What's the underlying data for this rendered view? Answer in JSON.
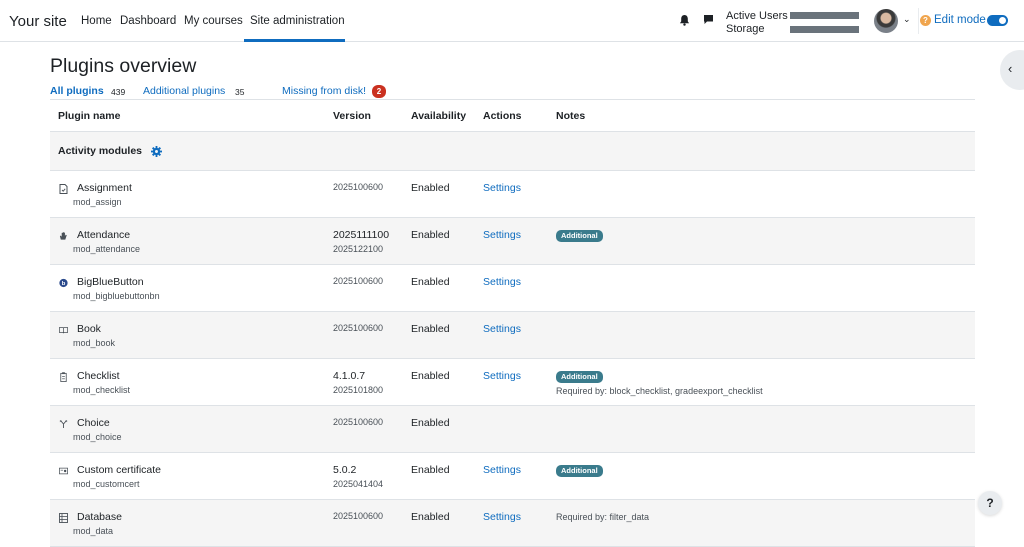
{
  "navbar": {
    "site_name": "Your site",
    "links": [
      "Home",
      "Dashboard",
      "My courses",
      "Site administration"
    ],
    "active_link": "Site administration",
    "usage": {
      "active_users_label": "Active Users",
      "storage_label": "Storage"
    },
    "edit_mode_label": "Edit mode",
    "edit_mode_on": true,
    "help_icon_glyph": "?",
    "caret": "⌄"
  },
  "page": {
    "title": "Plugins overview",
    "drawer_toggle": "‹",
    "tabs": {
      "all": {
        "label": "All plugins",
        "count": "439"
      },
      "additional": {
        "label": "Additional plugins",
        "count": "35"
      },
      "missing": {
        "label": "Missing from disk!",
        "count": "2"
      }
    }
  },
  "table": {
    "headers": {
      "name": "Plugin name",
      "version": "Version",
      "availability": "Availability",
      "actions": "Actions",
      "notes": "Notes"
    },
    "group": "Activity modules",
    "rows": [
      {
        "name": "Assignment",
        "component": "mod_assign",
        "version": "2025100600",
        "version_sub": "",
        "availability": "Enabled",
        "action": "Settings",
        "badge": "",
        "note": ""
      },
      {
        "name": "Attendance",
        "component": "mod_attendance",
        "version": "2025111100",
        "version_sub": "2025122100",
        "availability": "Enabled",
        "action": "Settings",
        "badge": "Additional",
        "note": ""
      },
      {
        "name": "BigBlueButton",
        "component": "mod_bigbluebuttonbn",
        "version": "2025100600",
        "version_sub": "",
        "availability": "Enabled",
        "action": "Settings",
        "badge": "",
        "note": ""
      },
      {
        "name": "Book",
        "component": "mod_book",
        "version": "2025100600",
        "version_sub": "",
        "availability": "Enabled",
        "action": "Settings",
        "badge": "",
        "note": ""
      },
      {
        "name": "Checklist",
        "component": "mod_checklist",
        "version": "4.1.0.7",
        "version_sub": "2025101800",
        "availability": "Enabled",
        "action": "Settings",
        "badge": "Additional",
        "note": "Required by: block_checklist, gradeexport_checklist"
      },
      {
        "name": "Choice",
        "component": "mod_choice",
        "version": "2025100600",
        "version_sub": "",
        "availability": "Enabled",
        "action": "",
        "badge": "",
        "note": ""
      },
      {
        "name": "Custom certificate",
        "component": "mod_customcert",
        "version": "5.0.2",
        "version_sub": "2025041404",
        "availability": "Enabled",
        "action": "Settings",
        "badge": "Additional",
        "note": ""
      },
      {
        "name": "Database",
        "component": "mod_data",
        "version": "2025100600",
        "version_sub": "",
        "availability": "Enabled",
        "action": "Settings",
        "badge": "",
        "note": "Required by: filter_data"
      }
    ]
  },
  "footer": {
    "help_glyph": "?"
  },
  "colors": {
    "primary": "#0f6cbf",
    "badge": "#3a7b8c",
    "danger": "#ca3120"
  }
}
